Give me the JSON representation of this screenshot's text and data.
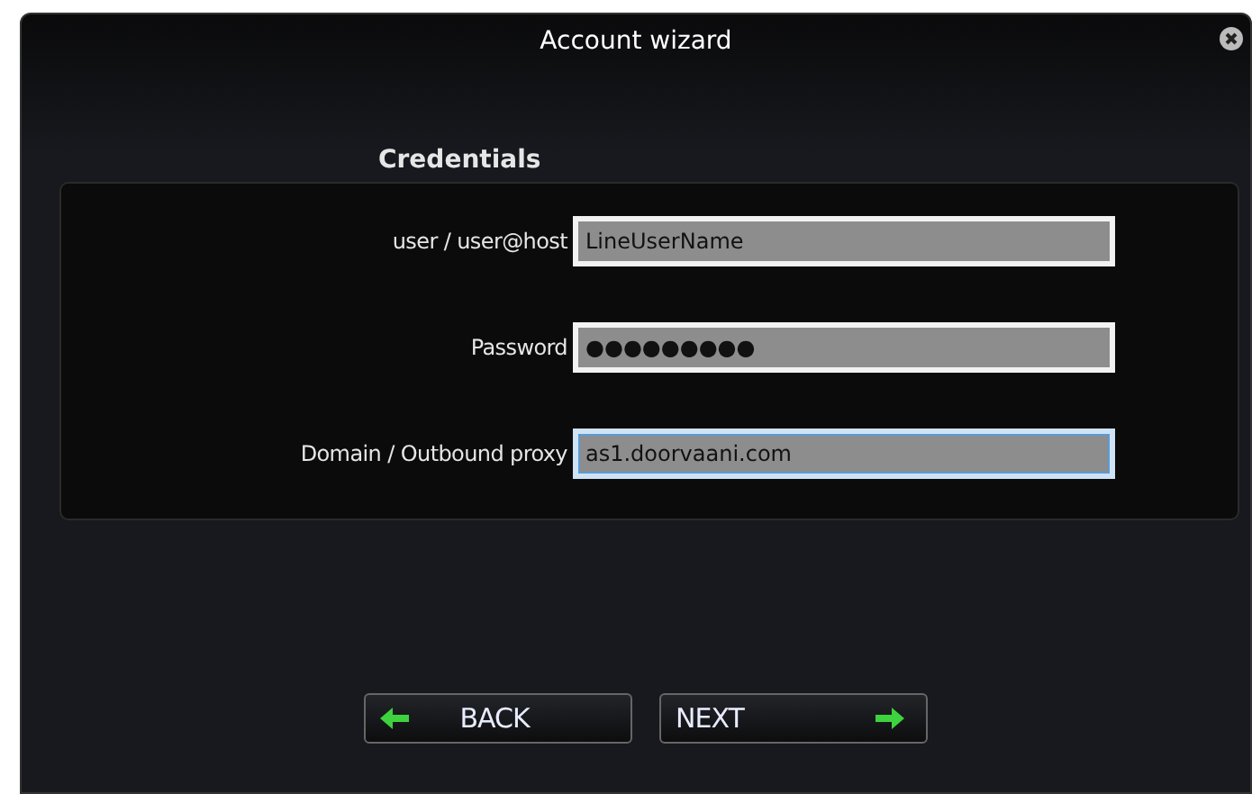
{
  "window": {
    "title": "Account wizard"
  },
  "section": {
    "title": "Credentials"
  },
  "fields": [
    {
      "label": "user / user@host",
      "value": "LineUserName",
      "focused": false
    },
    {
      "label": "Password",
      "value": "●●●●●●●●●",
      "focused": false
    },
    {
      "label": "Domain / Outbound proxy",
      "value": "as1.doorvaani.com",
      "focused": true
    }
  ],
  "buttons": [
    {
      "label": "BACK",
      "kind": "back"
    },
    {
      "label": "NEXT",
      "kind": "next"
    }
  ]
}
